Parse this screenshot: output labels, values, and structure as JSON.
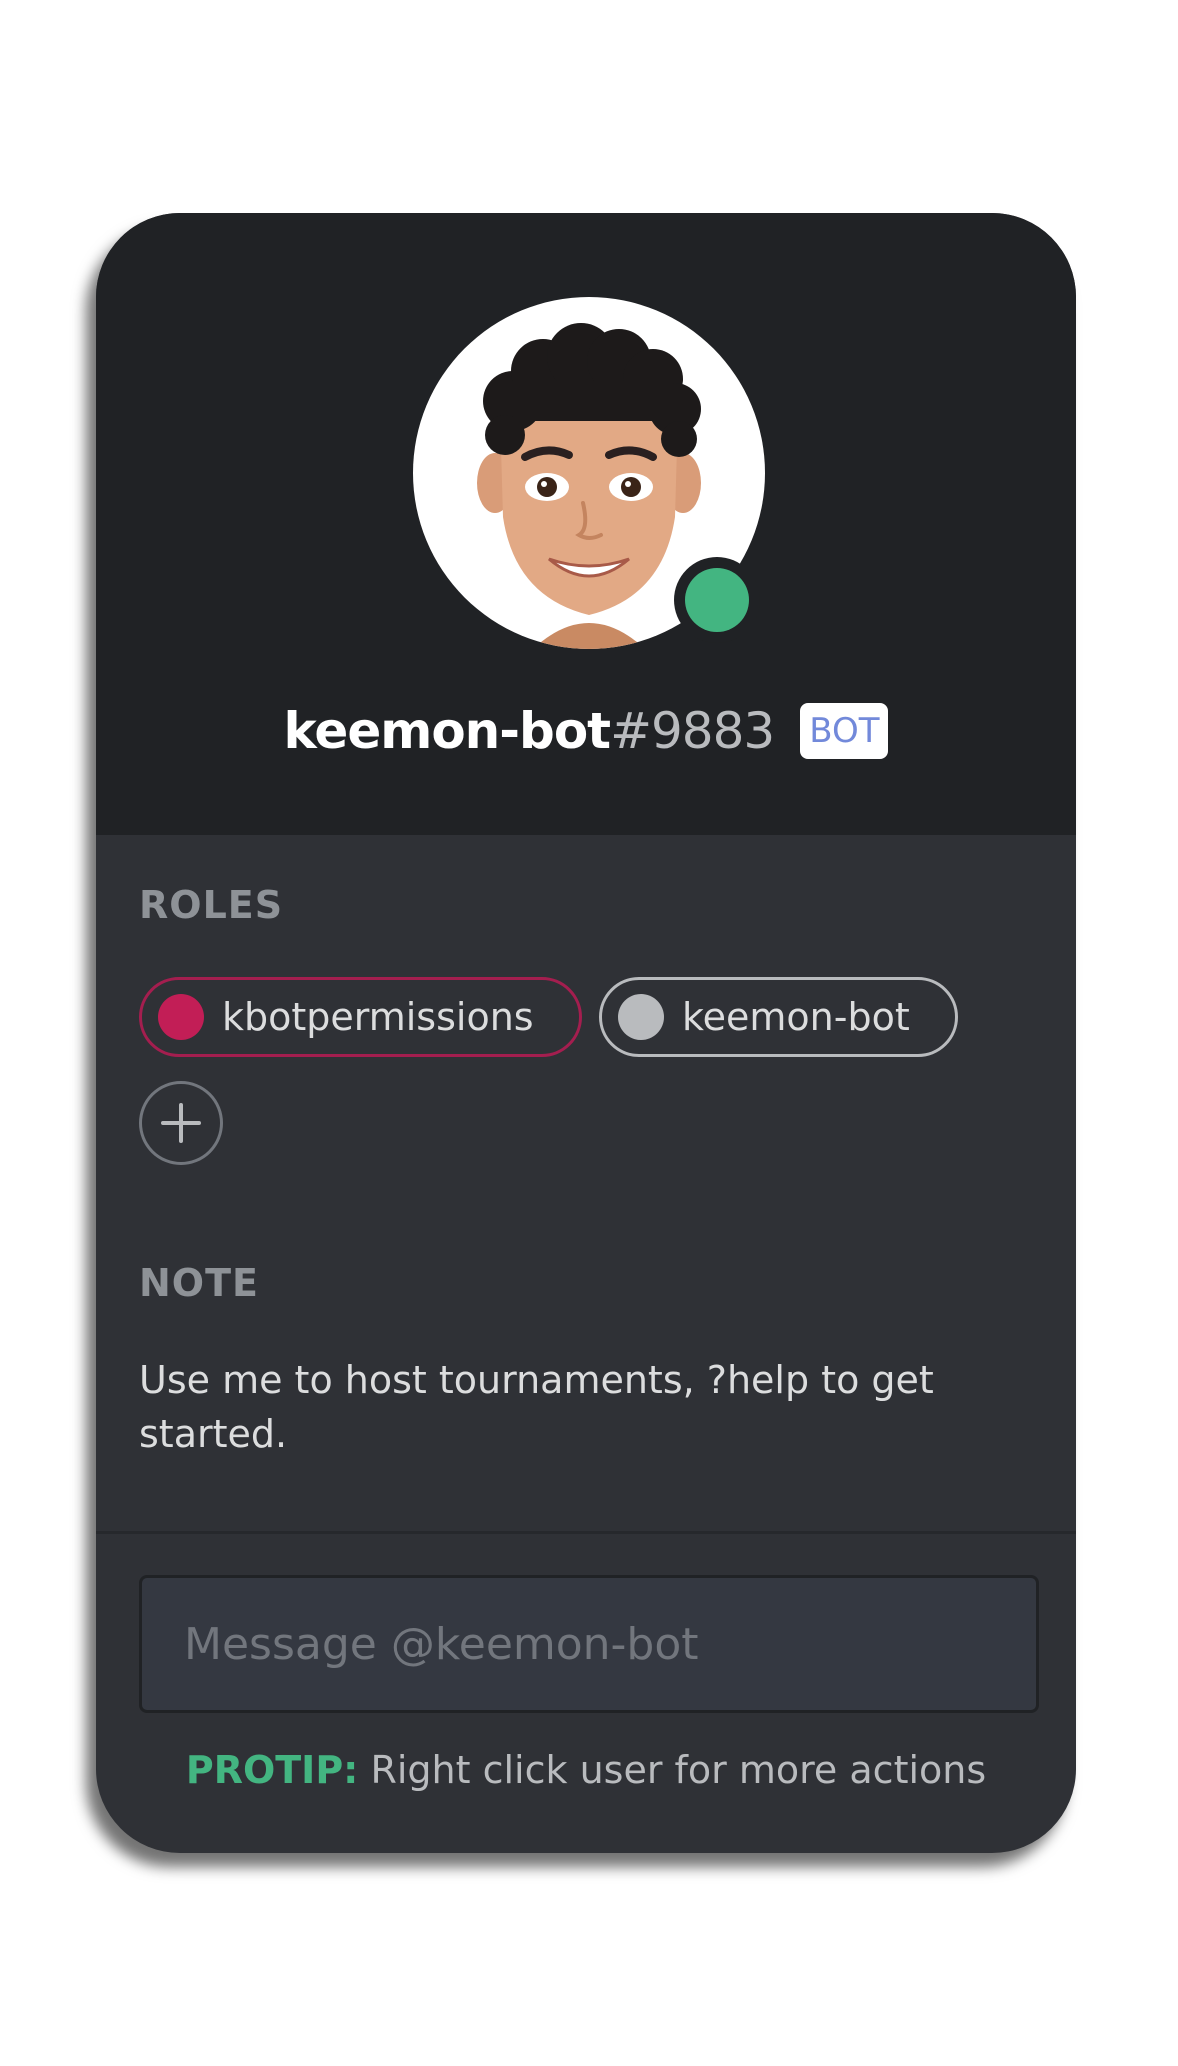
{
  "profile": {
    "username": "keemon-bot",
    "discriminator": "#9883",
    "bot_tag": "BOT",
    "status_color": "#43b581"
  },
  "roles_section": {
    "label": "ROLES",
    "roles": [
      {
        "name": "kbotpermissions",
        "color": "#c21e56"
      },
      {
        "name": "keemon-bot",
        "color": "#b9bbbe"
      }
    ],
    "add_role_icon": "plus-icon"
  },
  "note_section": {
    "label": "NOTE",
    "text": "Use me to host tournaments, ?help to get started."
  },
  "message": {
    "placeholder": "Message @keemon-bot",
    "value": ""
  },
  "protip": {
    "label": "PROTIP:",
    "text": " Right click user for more actions"
  },
  "colors": {
    "header_bg": "#202225",
    "body_bg": "#2f3136",
    "accent_green": "#43b581",
    "bot_tag_text": "#7289da"
  }
}
